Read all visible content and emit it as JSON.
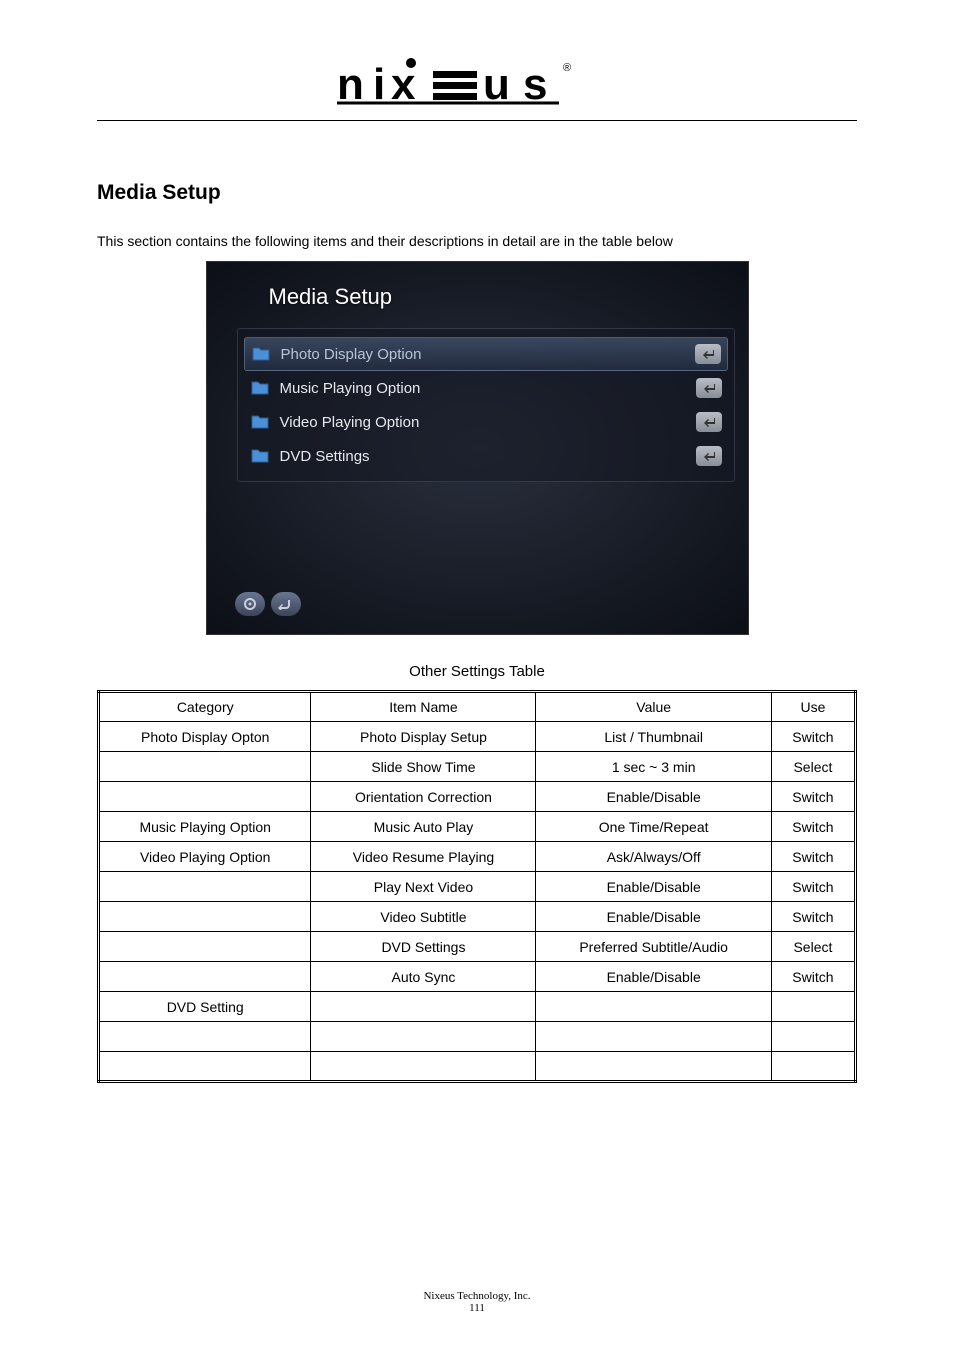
{
  "logo": {
    "text": "nixeus",
    "reg_mark": "®"
  },
  "heading": "Media Setup",
  "intro": "This section contains the following items and their descriptions in detail are in the table below",
  "screenshot": {
    "title": "Media Setup",
    "items": [
      {
        "label": "Photo Display Option",
        "selected": true
      },
      {
        "label": "Music Playing Option",
        "selected": false
      },
      {
        "label": "Video Playing Option",
        "selected": false
      },
      {
        "label": "DVD Settings",
        "selected": false
      }
    ]
  },
  "table": {
    "caption": "Other Settings Table",
    "headers": [
      "Category",
      "Item Name",
      "Value",
      "Use"
    ],
    "rows": [
      [
        "Photo Display Opton",
        "Photo Display Setup",
        "List / Thumbnail",
        "Switch"
      ],
      [
        "",
        "Slide Show Time",
        "1 sec ~ 3 min",
        "Select"
      ],
      [
        "",
        "Orientation Correction",
        "Enable/Disable",
        "Switch"
      ],
      [
        "Music Playing Option",
        "Music Auto Play",
        "One Time/Repeat",
        "Switch"
      ],
      [
        "Video Playing Option",
        "Video Resume Playing",
        "Ask/Always/Off",
        "Switch"
      ],
      [
        "",
        "Play Next Video",
        "Enable/Disable",
        "Switch"
      ],
      [
        "",
        "Video Subtitle",
        "Enable/Disable",
        "Switch"
      ],
      [
        "",
        "DVD Settings",
        "Preferred Subtitle/Audio",
        "Select"
      ],
      [
        "",
        "Auto Sync",
        "Enable/Disable",
        "Switch"
      ],
      [
        "DVD Setting",
        "",
        "",
        ""
      ],
      [
        "",
        "",
        "",
        ""
      ],
      [
        "",
        "",
        "",
        ""
      ]
    ]
  },
  "footer": {
    "company": "Nixeus Technology, Inc.",
    "page": "111"
  }
}
